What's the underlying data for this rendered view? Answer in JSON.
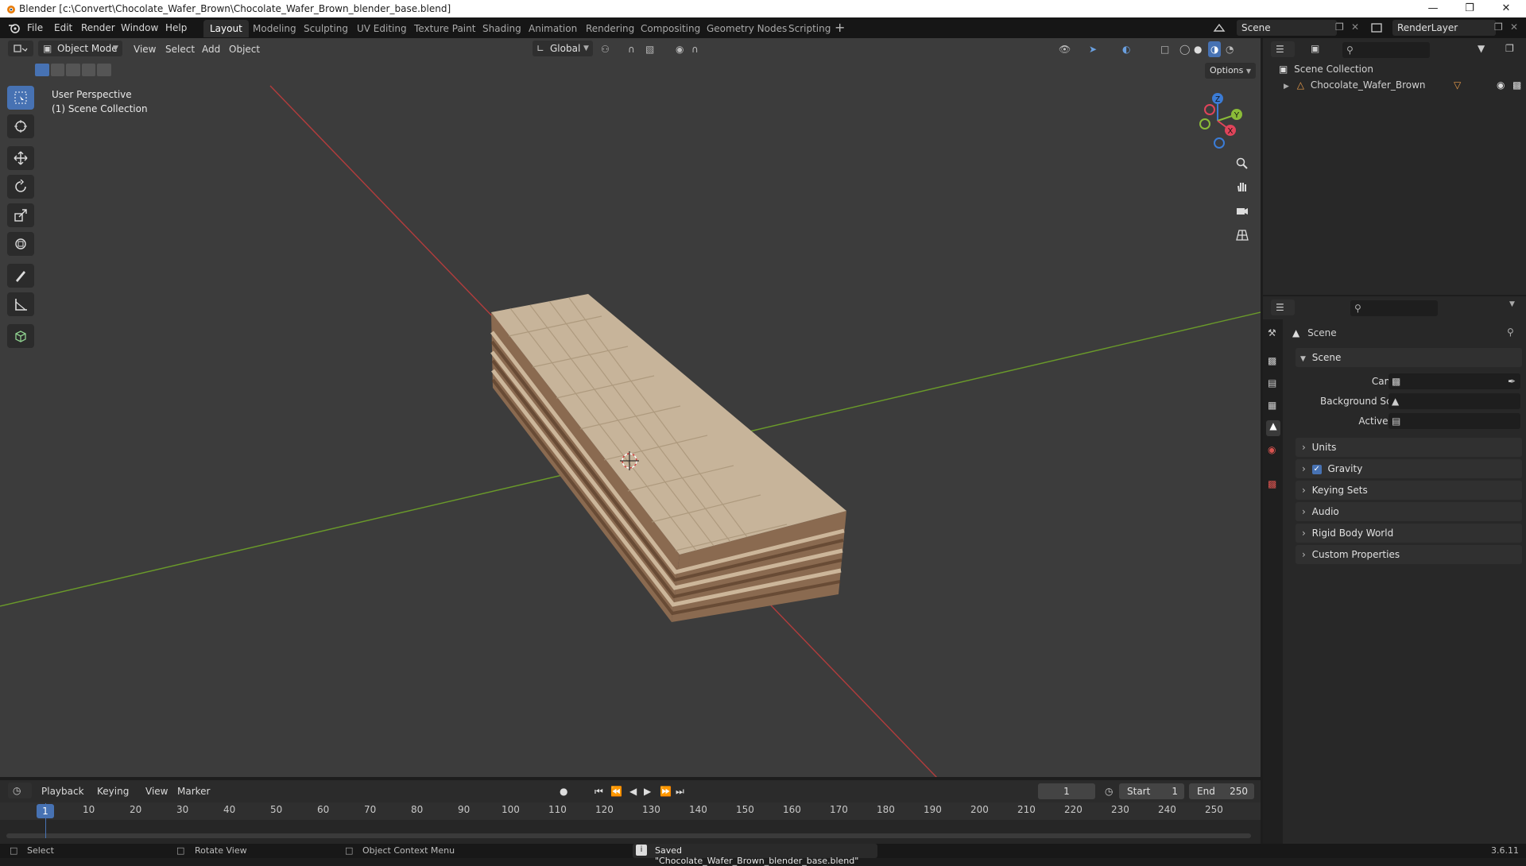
{
  "window": {
    "title": "Blender [c:\\Convert\\Chocolate_Wafer_Brown\\Chocolate_Wafer_Brown_blender_base.blend]"
  },
  "menu": [
    "File",
    "Edit",
    "Render",
    "Window",
    "Help"
  ],
  "workspaces": [
    {
      "label": "Layout",
      "active": true
    },
    {
      "label": "Modeling"
    },
    {
      "label": "Sculpting"
    },
    {
      "label": "UV Editing"
    },
    {
      "label": "Texture Paint"
    },
    {
      "label": "Shading"
    },
    {
      "label": "Animation"
    },
    {
      "label": "Rendering"
    },
    {
      "label": "Compositing"
    },
    {
      "label": "Geometry Nodes"
    },
    {
      "label": "Scripting"
    }
  ],
  "scene_selector": {
    "value": "Scene"
  },
  "view_layer": {
    "value": "RenderLayer"
  },
  "viewport": {
    "mode": "Object Mode",
    "menus": [
      "View",
      "Select",
      "Add",
      "Object"
    ],
    "transform_orientation": "Global",
    "options_label": "Options",
    "overlay_line1": "User Perspective",
    "overlay_line2": "(1) Scene Collection",
    "gizmo_axes": {
      "x": "X",
      "y": "Y",
      "z": "Z"
    }
  },
  "outliner": {
    "root": "Scene Collection",
    "items": [
      "Chocolate_Wafer_Brown"
    ]
  },
  "properties": {
    "header": "Scene",
    "panel_open": "Scene",
    "fields": [
      {
        "label": "Camera",
        "value": ""
      },
      {
        "label": "Background Scene",
        "value": ""
      },
      {
        "label": "Active Clip",
        "value": ""
      }
    ],
    "panels": [
      {
        "label": "Units"
      },
      {
        "label": "Gravity",
        "checked": true
      },
      {
        "label": "Keying Sets"
      },
      {
        "label": "Audio"
      },
      {
        "label": "Rigid Body World"
      },
      {
        "label": "Custom Properties"
      }
    ]
  },
  "timeline": {
    "menus": [
      "Playback",
      "Keying",
      "View",
      "Marker"
    ],
    "current_frame": "1",
    "start_label": "Start",
    "start": "1",
    "end_label": "End",
    "end": "250",
    "ruler": [
      "10",
      "20",
      "30",
      "40",
      "50",
      "60",
      "70",
      "80",
      "90",
      "100",
      "110",
      "120",
      "130",
      "140",
      "150",
      "160",
      "170",
      "180",
      "190",
      "200",
      "210",
      "220",
      "230",
      "240",
      "250"
    ],
    "playhead_label": "1"
  },
  "statusbar": {
    "select": "Select",
    "rotate": "Rotate View",
    "context": "Object Context Menu",
    "message": "Saved \"Chocolate_Wafer_Brown_blender_base.blend\"",
    "version": "3.6.11"
  },
  "colors": {
    "accent": "#4772b3",
    "axis_x": "#b33c3c",
    "axis_y": "#6a9a2a",
    "viewport_bg": "#3c3c3c",
    "wafer_top": "#c7b49a",
    "wafer_side": "#8a6a50"
  }
}
